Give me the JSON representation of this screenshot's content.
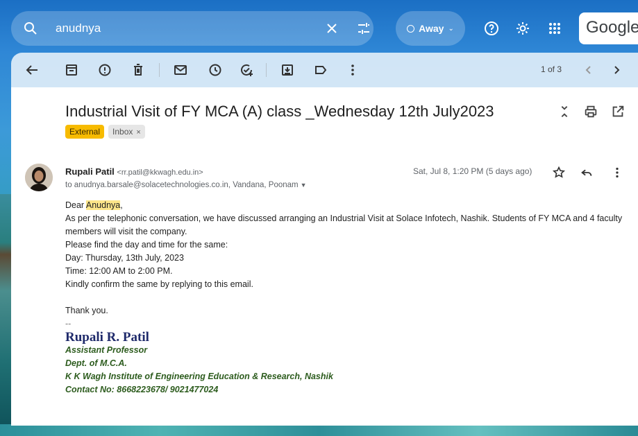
{
  "search": {
    "query": "anudnya"
  },
  "status": {
    "label": "Away"
  },
  "brand": {
    "logo_text": "Google"
  },
  "toolbar": {
    "pagination": "1 of 3"
  },
  "email": {
    "subject": "Industrial Visit of FY MCA (A) class _Wednesday 12th July2023",
    "labels": {
      "external": "External",
      "inbox": "Inbox",
      "remove": "×"
    },
    "sender_name": "Rupali Patil",
    "sender_email": "<rr.patil@kkwagh.edu.in>",
    "recipients": "to anudnya.barsale@solacetechnologies.co.in, Vandana, Poonam",
    "date": "Sat, Jul 8, 1:20 PM (5 days ago)",
    "greeting_prefix": "Dear ",
    "greeting_name": "Anudnya",
    "greeting_suffix": ",",
    "body_lines": [
      "As per the telephonic conversation, we have discussed arranging an Industrial Visit at Solace Infotech, Nashik. Students of FY MCA and 4 faculty members will visit the company.",
      "Please find the day and time for the same:",
      "Day: Thursday, 13th July, 2023",
      "Time: 12:00 AM to 2:00 PM.",
      "Kindly confirm the same by replying to this email."
    ],
    "closing": "Thank you.",
    "sig_dash": "--",
    "signature": {
      "name": "Rupali R. Patil",
      "title": "Assistant Professor",
      "dept": "Dept. of M.C.A.",
      "institute": "K K Wagh Institute of Engineering Education & Research, Nashik",
      "contact": "Contact No: 8668223678/ 9021477024"
    }
  },
  "colors": {
    "external_label": "#f7bb00",
    "signature_name": "#1f2a6b",
    "signature_text": "#2d5c1e"
  }
}
